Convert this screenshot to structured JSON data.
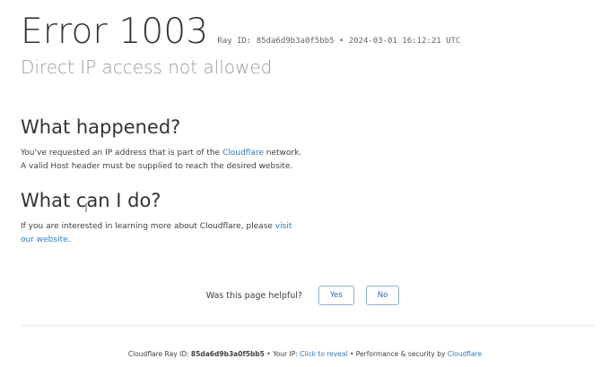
{
  "header": {
    "error_title": "Error 1003",
    "ray_info": "Ray ID: 85da6d9b3a0f5bb5 • 2024-03-01 16:12:21 UTC",
    "subtitle": "Direct IP access not allowed"
  },
  "what_happened": {
    "heading": "What happened?",
    "line1_pre": "You've requested an IP address that is part of the ",
    "line1_link": "Cloudflare",
    "line1_post": " network.",
    "line2": "A valid Host header must be supplied to reach the desired website."
  },
  "what_can_i_do": {
    "heading": "What can I do?",
    "text_pre": "If you are interested in learning more about Cloudflare, please ",
    "link": "visit our website",
    "text_post": "."
  },
  "feedback": {
    "question": "Was this page helpful?",
    "yes_label": "Yes",
    "no_label": "No"
  },
  "footer": {
    "ray_prefix": "Cloudflare Ray ID: ",
    "ray_id": "85da6d9b3a0f5bb5",
    "sep1": " • Your IP: ",
    "reveal_link": "Click to reveal",
    "sep2": " • Performance & security by ",
    "cloudflare_link": "Cloudflare"
  },
  "colors": {
    "link": "#2f7bbf",
    "title": "#333333",
    "subtitle": "#9a9a9a"
  }
}
